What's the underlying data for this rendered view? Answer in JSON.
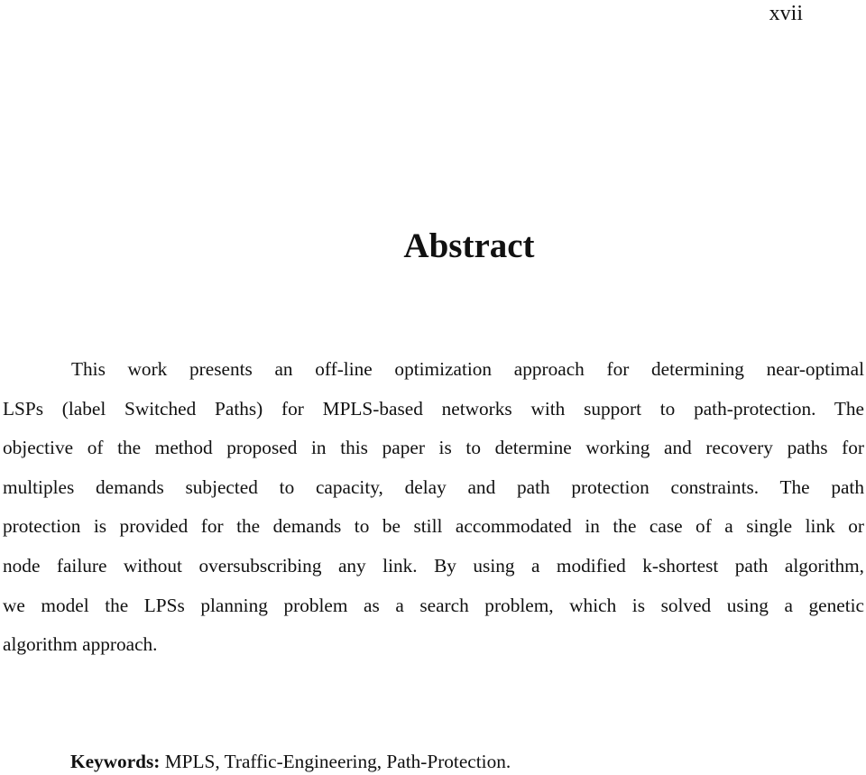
{
  "page_number": "xvii",
  "title": "Abstract",
  "abstract_lines": [
    "This work presents an off-line optimization approach for determining near-optimal",
    "LSPs (label Switched Paths) for MPLS-based networks with support to path-protection. The",
    "objective of the method proposed in this paper is to determine working and recovery paths for",
    "multiples demands subjected to capacity, delay and path protection constraints. The path",
    "protection is provided for the demands to be still accommodated in the case of a single link or",
    "node failure without oversubscribing any link. By using a modified k-shortest path algorithm,",
    "we model the LPSs planning problem as a search problem, which is solved using a genetic",
    "algorithm approach."
  ],
  "keywords": {
    "label": "Keywords:",
    "value": " MPLS, Traffic-Engineering, Path-Protection."
  }
}
